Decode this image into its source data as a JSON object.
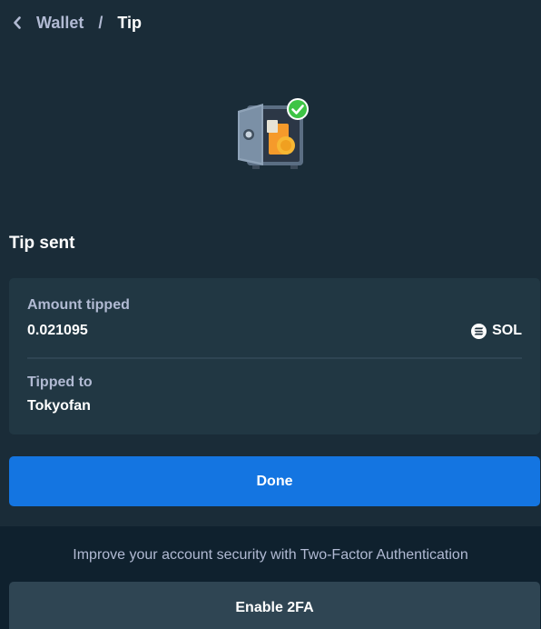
{
  "breadcrumb": {
    "parent": "Wallet",
    "separator": "/",
    "current": "Tip"
  },
  "status": {
    "title": "Tip sent",
    "illustration": "safe-with-checkmark-icon"
  },
  "details": {
    "amount_label": "Amount tipped",
    "amount_value": "0.021095",
    "currency": "SOL",
    "currency_icon": "solana-icon",
    "recipient_label": "Tipped to",
    "recipient_value": "Tokyofan"
  },
  "actions": {
    "done_label": "Done"
  },
  "security": {
    "message": "Improve your account security with Two-Factor Authentication",
    "enable_label": "Enable 2FA"
  },
  "colors": {
    "background": "#1a2c38",
    "card": "#213743",
    "primary": "#1475e1",
    "secondary_button": "#2f4553",
    "footer": "#0f212e",
    "muted_text": "#b1bad3",
    "success": "#1fff20"
  }
}
